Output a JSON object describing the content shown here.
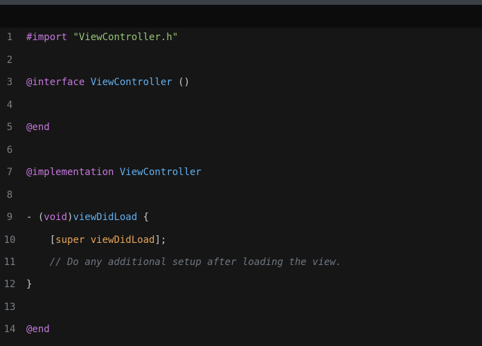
{
  "editor": {
    "lines": [
      {
        "n": "1",
        "parts": [
          [
            "kw",
            "#import "
          ],
          [
            "str",
            "\"ViewController.h\""
          ]
        ]
      },
      {
        "n": "2",
        "parts": []
      },
      {
        "n": "3",
        "parts": [
          [
            "kw",
            "@interface "
          ],
          [
            "cls",
            "ViewController"
          ],
          [
            "plain",
            " ()"
          ]
        ]
      },
      {
        "n": "4",
        "parts": []
      },
      {
        "n": "5",
        "parts": [
          [
            "kw",
            "@end"
          ]
        ]
      },
      {
        "n": "6",
        "parts": []
      },
      {
        "n": "7",
        "parts": [
          [
            "kw",
            "@implementation "
          ],
          [
            "cls",
            "ViewController"
          ]
        ]
      },
      {
        "n": "8",
        "parts": []
      },
      {
        "n": "9",
        "parts": [
          [
            "plain",
            "- ("
          ],
          [
            "type",
            "void"
          ],
          [
            "plain",
            ")"
          ],
          [
            "fn",
            "viewDidLoad"
          ],
          [
            "plain",
            " {"
          ]
        ]
      },
      {
        "n": "10",
        "parts": [
          [
            "plain",
            "    ["
          ],
          [
            "super",
            "super viewDidLoad"
          ],
          [
            "plain",
            "];"
          ]
        ]
      },
      {
        "n": "11",
        "parts": [
          [
            "plain",
            "    "
          ],
          [
            "cmt",
            "// Do any additional setup after loading the view."
          ]
        ]
      },
      {
        "n": "12",
        "parts": [
          [
            "plain",
            "}"
          ]
        ]
      },
      {
        "n": "13",
        "parts": []
      },
      {
        "n": "14",
        "parts": [
          [
            "kw",
            "@end"
          ]
        ]
      }
    ]
  },
  "colors": {
    "keyword": "#c678dd",
    "string": "#98c379",
    "class": "#61afef",
    "comment": "#6f7782",
    "line_number": "#7a7f87",
    "background": "#161616"
  }
}
